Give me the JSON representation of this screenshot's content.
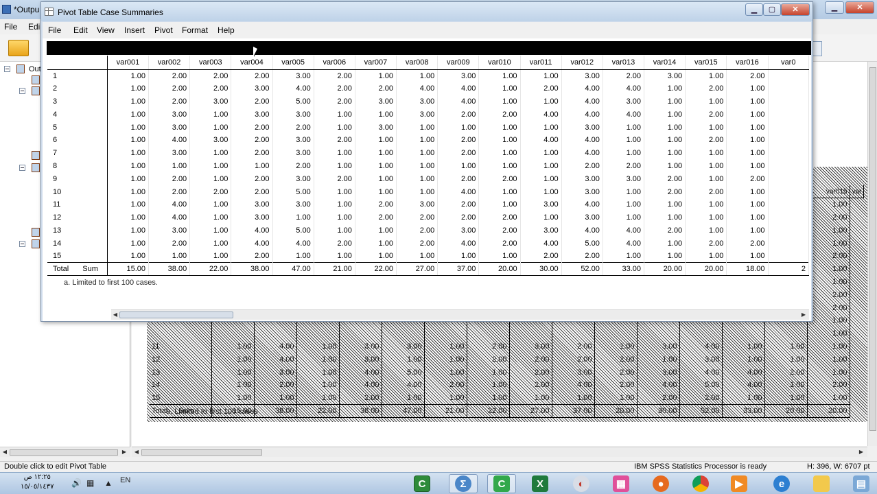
{
  "bg": {
    "title": "*Outpu",
    "menu": [
      "File",
      "Edi"
    ],
    "tree_label": "Out",
    "status_left": "Double click to edit Pivot Table",
    "status_mid": "IBM SPSS Statistics Processor is ready",
    "status_right": "H: 396, W: 6707 pt",
    "table": {
      "head": [
        "var015",
        "var"
      ],
      "top_values": [
        "1.00",
        "2.00",
        "1.00",
        "1.00",
        "2.00",
        "1.00",
        "1.00",
        "2.00",
        "2.00",
        "1.00",
        "1.00"
      ],
      "rows": [
        {
          "label": "11",
          "values": [
            "1.00",
            "4.00",
            "1.00",
            "3.00",
            "3.00",
            "1.00",
            "2.00",
            "3.00",
            "2.00",
            "1.00",
            "3.00",
            "4.00",
            "1.00",
            "1.00",
            "1.00"
          ]
        },
        {
          "label": "12",
          "values": [
            "1.00",
            "4.00",
            "1.00",
            "3.00",
            "1.00",
            "1.00",
            "2.00",
            "2.00",
            "2.00",
            "2.00",
            "1.00",
            "3.00",
            "1.00",
            "1.00",
            "1.00"
          ]
        },
        {
          "label": "13",
          "values": [
            "1.00",
            "3.00",
            "1.00",
            "4.00",
            "5.00",
            "1.00",
            "1.00",
            "2.00",
            "3.00",
            "2.00",
            "3.00",
            "4.00",
            "4.00",
            "2.00",
            "1.00"
          ]
        },
        {
          "label": "14",
          "values": [
            "1.00",
            "2.00",
            "1.00",
            "4.00",
            "4.00",
            "2.00",
            "1.00",
            "2.00",
            "4.00",
            "2.00",
            "4.00",
            "5.00",
            "4.00",
            "1.00",
            "2.00"
          ]
        },
        {
          "label": "15",
          "values": [
            "1.00",
            "1.00",
            "1.00",
            "2.00",
            "1.00",
            "1.00",
            "1.00",
            "1.00",
            "1.00",
            "1.00",
            "2.00",
            "2.00",
            "1.00",
            "1.00",
            "1.00"
          ]
        }
      ],
      "total_label": "Total",
      "sum_label": "Sum",
      "total_values": [
        "15.00",
        "38.00",
        "22.00",
        "38.00",
        "47.00",
        "21.00",
        "22.00",
        "27.00",
        "37.00",
        "20.00",
        "30.00",
        "52.00",
        "33.00",
        "20.00",
        "20.00"
      ],
      "note": "a. Limited to first 100 cases"
    }
  },
  "pivot": {
    "title": "Pivot Table Case Summaries",
    "menu": [
      "File",
      "Edit",
      "View",
      "Insert",
      "Pivot",
      "Format",
      "Help"
    ],
    "columns": [
      "var001",
      "var002",
      "var003",
      "var004",
      "var005",
      "var006",
      "var007",
      "var008",
      "var009",
      "var010",
      "var011",
      "var012",
      "var013",
      "var014",
      "var015",
      "var016",
      "var0"
    ],
    "rows": [
      {
        "label": "1",
        "values": [
          "1.00",
          "2.00",
          "2.00",
          "2.00",
          "3.00",
          "2.00",
          "1.00",
          "1.00",
          "3.00",
          "1.00",
          "1.00",
          "3.00",
          "2.00",
          "3.00",
          "1.00",
          "2.00"
        ]
      },
      {
        "label": "2",
        "values": [
          "1.00",
          "2.00",
          "2.00",
          "3.00",
          "4.00",
          "2.00",
          "2.00",
          "4.00",
          "4.00",
          "1.00",
          "2.00",
          "4.00",
          "4.00",
          "1.00",
          "2.00",
          "1.00"
        ]
      },
      {
        "label": "3",
        "values": [
          "1.00",
          "2.00",
          "3.00",
          "2.00",
          "5.00",
          "2.00",
          "3.00",
          "3.00",
          "4.00",
          "1.00",
          "1.00",
          "4.00",
          "3.00",
          "1.00",
          "1.00",
          "1.00"
        ]
      },
      {
        "label": "4",
        "values": [
          "1.00",
          "3.00",
          "1.00",
          "3.00",
          "3.00",
          "1.00",
          "1.00",
          "3.00",
          "2.00",
          "2.00",
          "4.00",
          "4.00",
          "4.00",
          "1.00",
          "2.00",
          "1.00"
        ]
      },
      {
        "label": "5",
        "values": [
          "1.00",
          "3.00",
          "1.00",
          "2.00",
          "2.00",
          "1.00",
          "3.00",
          "1.00",
          "1.00",
          "1.00",
          "1.00",
          "3.00",
          "1.00",
          "1.00",
          "1.00",
          "1.00"
        ]
      },
      {
        "label": "6",
        "values": [
          "1.00",
          "4.00",
          "3.00",
          "2.00",
          "3.00",
          "2.00",
          "1.00",
          "1.00",
          "2.00",
          "1.00",
          "4.00",
          "4.00",
          "1.00",
          "1.00",
          "2.00",
          "1.00"
        ]
      },
      {
        "label": "7",
        "values": [
          "1.00",
          "3.00",
          "1.00",
          "2.00",
          "3.00",
          "1.00",
          "1.00",
          "1.00",
          "2.00",
          "1.00",
          "1.00",
          "4.00",
          "1.00",
          "1.00",
          "1.00",
          "1.00"
        ]
      },
      {
        "label": "8",
        "values": [
          "1.00",
          "1.00",
          "1.00",
          "1.00",
          "2.00",
          "1.00",
          "1.00",
          "1.00",
          "1.00",
          "1.00",
          "1.00",
          "2.00",
          "2.00",
          "1.00",
          "1.00",
          "1.00"
        ]
      },
      {
        "label": "9",
        "values": [
          "1.00",
          "2.00",
          "1.00",
          "2.00",
          "3.00",
          "2.00",
          "1.00",
          "1.00",
          "2.00",
          "2.00",
          "1.00",
          "3.00",
          "3.00",
          "2.00",
          "1.00",
          "2.00"
        ]
      },
      {
        "label": "10",
        "values": [
          "1.00",
          "2.00",
          "2.00",
          "2.00",
          "5.00",
          "1.00",
          "1.00",
          "1.00",
          "4.00",
          "1.00",
          "1.00",
          "3.00",
          "1.00",
          "2.00",
          "2.00",
          "1.00"
        ]
      },
      {
        "label": "11",
        "values": [
          "1.00",
          "4.00",
          "1.00",
          "3.00",
          "3.00",
          "1.00",
          "2.00",
          "3.00",
          "2.00",
          "1.00",
          "3.00",
          "4.00",
          "1.00",
          "1.00",
          "1.00",
          "1.00"
        ]
      },
      {
        "label": "12",
        "values": [
          "1.00",
          "4.00",
          "1.00",
          "3.00",
          "1.00",
          "1.00",
          "2.00",
          "2.00",
          "2.00",
          "2.00",
          "1.00",
          "3.00",
          "1.00",
          "1.00",
          "1.00",
          "1.00"
        ]
      },
      {
        "label": "13",
        "values": [
          "1.00",
          "3.00",
          "1.00",
          "4.00",
          "5.00",
          "1.00",
          "1.00",
          "2.00",
          "3.00",
          "2.00",
          "3.00",
          "4.00",
          "4.00",
          "2.00",
          "1.00",
          "1.00"
        ]
      },
      {
        "label": "14",
        "values": [
          "1.00",
          "2.00",
          "1.00",
          "4.00",
          "4.00",
          "2.00",
          "1.00",
          "2.00",
          "4.00",
          "2.00",
          "4.00",
          "5.00",
          "4.00",
          "1.00",
          "2.00",
          "2.00"
        ]
      },
      {
        "label": "15",
        "values": [
          "1.00",
          "1.00",
          "1.00",
          "2.00",
          "1.00",
          "1.00",
          "1.00",
          "1.00",
          "1.00",
          "1.00",
          "2.00",
          "2.00",
          "1.00",
          "1.00",
          "1.00",
          "1.00"
        ]
      }
    ],
    "total_label": "Total",
    "sum_label": "Sum",
    "total_values": [
      "15.00",
      "38.00",
      "22.00",
      "38.00",
      "47.00",
      "21.00",
      "22.00",
      "27.00",
      "37.00",
      "20.00",
      "30.00",
      "52.00",
      "33.00",
      "20.00",
      "20.00",
      "18.00",
      "2"
    ],
    "note": "a. Limited to first 100 cases."
  },
  "taskbar": {
    "time": "١٢:٢٥ ص",
    "date": "١٥/٠٥/١٤٣٧",
    "lang": "EN"
  }
}
